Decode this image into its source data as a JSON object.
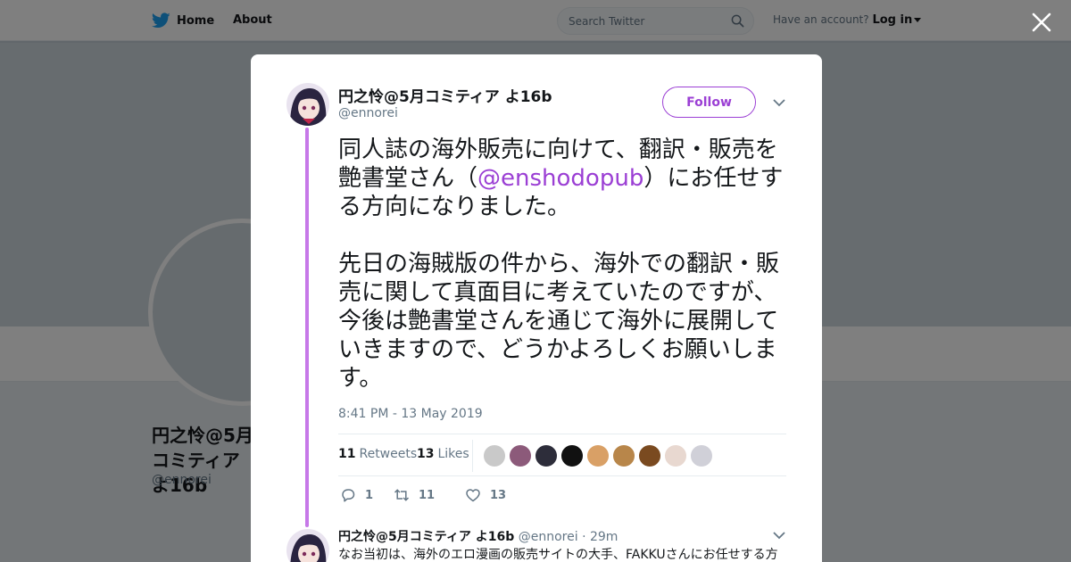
{
  "topbar": {
    "home_label": "Home",
    "about_label": "About",
    "search_placeholder": "Search Twitter",
    "account_prompt": "Have an account?",
    "login_label": "Log in"
  },
  "profile": {
    "name": "円之怜@5月コミティア よ16b",
    "handle": "@ennorei"
  },
  "tweet": {
    "author_name": "円之怜@5月コミティア よ16b",
    "author_handle": "@ennorei",
    "follow_label": "Follow",
    "text_p1_before": "同人誌の海外販売に向けて、翻訳・販売を艶書堂さん（",
    "text_p1_mention": "@enshodopub",
    "text_p1_after": "）にお任せする方向になりました。",
    "text_p2": "先日の海賊版の件から、海外での翻訳・販売に関して真面目に考えていたのですが、今後は艶書堂さんを通じて海外に展開していきますので、どうかよろしくお願いします。",
    "timestamp": "8:41 PM - 13 May 2019",
    "retweets_count": "11",
    "retweets_label": "Retweets",
    "likes_count": "13",
    "likes_label": "Likes",
    "actions": {
      "reply_count": "1",
      "retweet_count": "11",
      "like_count": "13"
    }
  },
  "reply": {
    "author_name": "円之怜@5月コミティア よ16b",
    "author_handle": "@ennorei",
    "separator": "·",
    "time": "29m",
    "text": "なお当初は、海外のエロ漫画の販売サイトの大手、FAKKUさんにお任せする方"
  },
  "colors": {
    "accent": "#9b3fd4",
    "thread_line": "#c678e8",
    "twitter_blue": "#1da1f2"
  }
}
